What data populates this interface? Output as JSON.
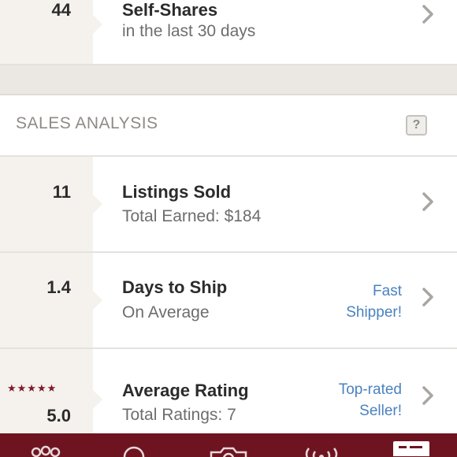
{
  "self_shares": {
    "value": "44",
    "title": "Self-Shares",
    "subtitle": "in the last 30 days"
  },
  "section": {
    "title": "SALES ANALYSIS",
    "help_label": "?"
  },
  "listings_sold": {
    "value": "11",
    "title": "Listings Sold",
    "subtitle": "Total Earned: $184"
  },
  "days_to_ship": {
    "value": "1.4",
    "title": "Days to Ship",
    "subtitle": "On Average",
    "badge_line1": "Fast",
    "badge_line2": "Shipper!"
  },
  "average_rating": {
    "stars": "★★★★★",
    "value": "5.0",
    "title": "Average Rating",
    "subtitle": "Total Ratings: 7",
    "badge_line1": "Top-rated",
    "badge_line2": "Seller!",
    "star_rating": 5
  },
  "colors": {
    "accent": "#6e1420",
    "link": "#4a82c0",
    "gutter": "#f5f2ee"
  },
  "tabbar": {
    "icons": [
      "people-icon",
      "search-icon",
      "camera-icon",
      "broadcast-icon",
      "news-icon"
    ]
  }
}
